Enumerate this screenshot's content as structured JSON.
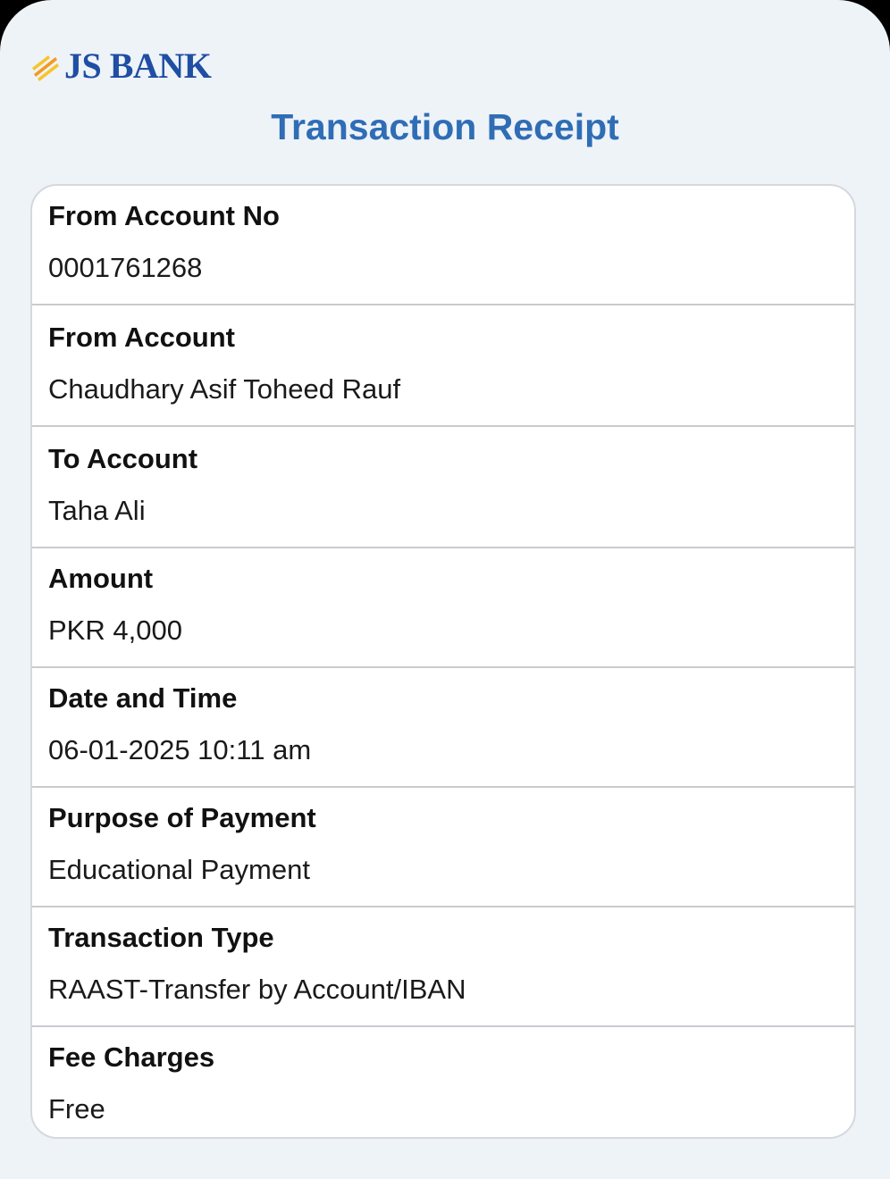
{
  "brand": {
    "name": "JS BANK",
    "colors": {
      "primary": "#1f4ea3",
      "title": "#2f6db5",
      "accent_orange": "#f39a1e",
      "accent_yellow": "#f7c52b"
    },
    "logo_icon": "js-bank-stripes-icon"
  },
  "header": {
    "title": "Transaction Receipt"
  },
  "receipt": {
    "rows": [
      {
        "label": "From Account No",
        "value": "0001761268"
      },
      {
        "label": "From Account",
        "value": "Chaudhary Asif Toheed Rauf"
      },
      {
        "label": "To Account",
        "value": "Taha Ali"
      },
      {
        "label": "Amount",
        "value": "PKR 4,000"
      },
      {
        "label": "Date and Time",
        "value": "06-01-2025 10:11 am"
      },
      {
        "label": "Purpose of Payment",
        "value": "Educational Payment"
      },
      {
        "label": "Transaction Type",
        "value": "RAAST-Transfer by Account/IBAN"
      },
      {
        "label": "Fee Charges",
        "value": "Free"
      }
    ]
  }
}
